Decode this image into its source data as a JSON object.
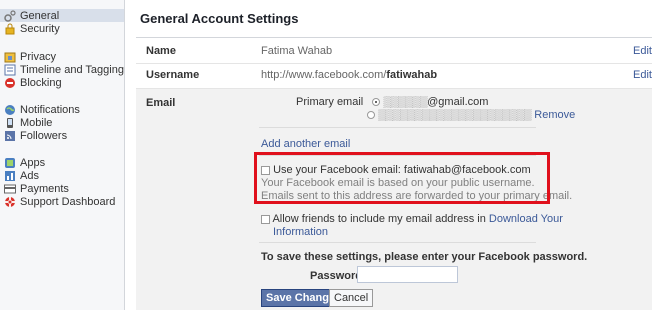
{
  "sidebar": {
    "groups": [
      [
        {
          "label": "General",
          "icon": "general-gear-icon"
        },
        {
          "label": "Security",
          "icon": "security-lock-icon"
        }
      ],
      [
        {
          "label": "Privacy",
          "icon": "privacy-lock-icon"
        },
        {
          "label": "Timeline and Tagging",
          "icon": "timeline-icon"
        },
        {
          "label": "Blocking",
          "icon": "blocking-icon"
        }
      ],
      [
        {
          "label": "Notifications",
          "icon": "notifications-globe-icon"
        },
        {
          "label": "Mobile",
          "icon": "mobile-icon"
        },
        {
          "label": "Followers",
          "icon": "followers-rss-icon"
        }
      ],
      [
        {
          "label": "Apps",
          "icon": "apps-icon"
        },
        {
          "label": "Ads",
          "icon": "ads-icon"
        },
        {
          "label": "Payments",
          "icon": "payments-card-icon"
        },
        {
          "label": "Support Dashboard",
          "icon": "support-lifebuoy-icon"
        }
      ]
    ]
  },
  "main": {
    "title": "General Account Settings",
    "name_row": {
      "label": "Name",
      "value": "Fatima Wahab",
      "edit": "Edit"
    },
    "username_row": {
      "label": "Username",
      "value_prefix": "http://www.facebook.com/",
      "value_bold": "fatiwahab",
      "edit": "Edit"
    },
    "email_row": {
      "label": "Email",
      "primary_label": "Primary email",
      "primary_email_suffix": "@gmail.com",
      "remove": "Remove",
      "add_another": "Add another email",
      "use_fb_email": "Use your Facebook email: fatiwahab@facebook.com",
      "fb_note_1": "Your Facebook email is based on your public username.",
      "fb_note_2": "Emails sent to this address are forwarded to your primary email.",
      "allow_friends_1": "Allow friends to include my email address in",
      "download_link_1": "Download Your",
      "download_link_2": "Information",
      "save_prompt": "To save these settings, please enter your Facebook password.",
      "password_label": "Password",
      "save_button": "Save Changes",
      "cancel_button": "Cancel"
    }
  },
  "colors": {
    "link": "#3b5998",
    "highlight": "#e0101c",
    "primary_button": "#5b74a8"
  }
}
